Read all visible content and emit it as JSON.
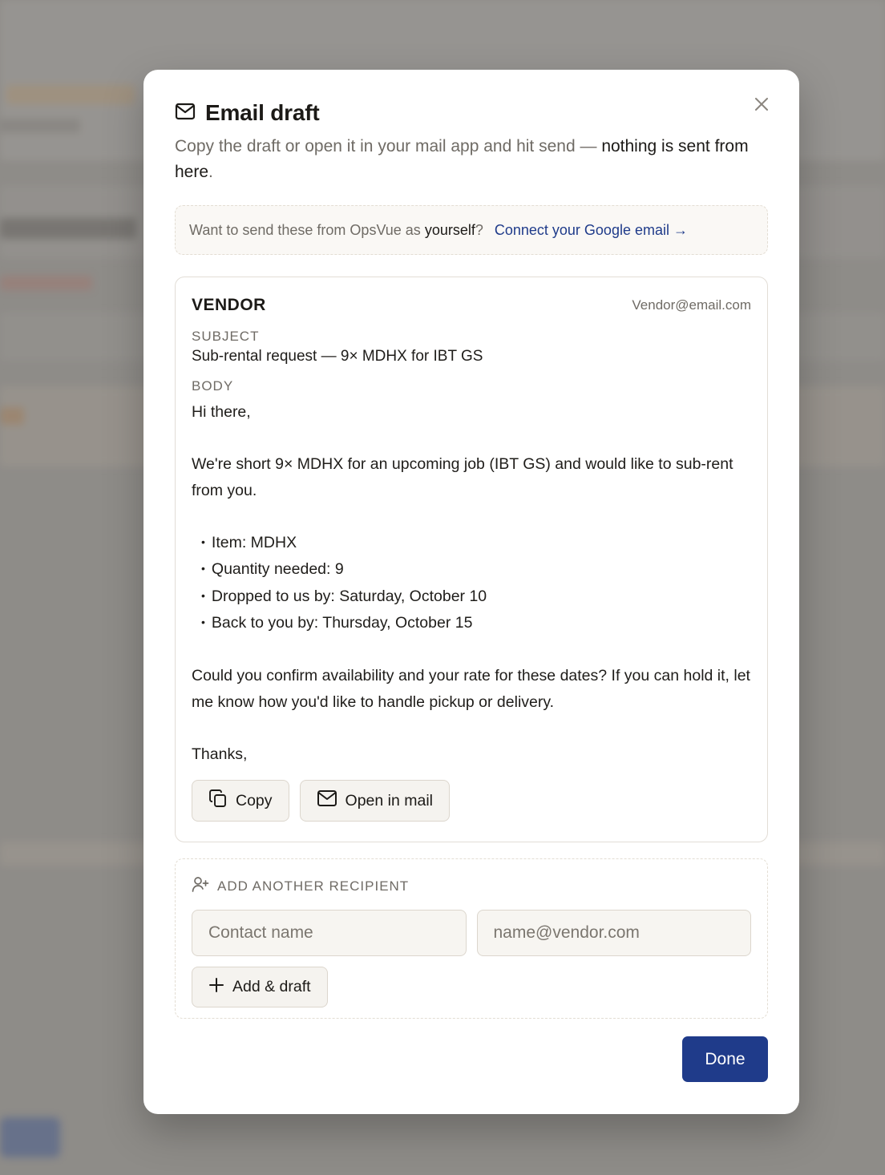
{
  "modal": {
    "title": "Email draft",
    "subtitle_prefix": "Copy the draft or open it in your mail app and hit send — ",
    "subtitle_strong": "nothing is sent from here",
    "subtitle_suffix": ".",
    "close_icon": "close-icon"
  },
  "connect": {
    "prefix": "Want to send these from OpsVue as ",
    "strong": "yourself",
    "suffix": "?",
    "link": "Connect your Google email →"
  },
  "draft": {
    "vendor_label": "VENDOR",
    "vendor_email": "Vendor@email.com",
    "subject_label": "SUBJECT",
    "subject": "Sub-rental request — 9× MDHX for IBT GS",
    "body_label": "BODY",
    "greeting": "Hi there,",
    "intro": "We're short 9× MDHX for an upcoming job (IBT GS) and would like to sub-rent from you.",
    "items": [
      "Item: MDHX",
      "Quantity needed: 9",
      "Dropped to us by: Saturday, October 10",
      "Back to you by: Thursday, October 15"
    ],
    "closing_question": "Could you confirm availability and your rate for these dates? If you can hold it, let me know how you'd like to handle pickup or delivery.",
    "signoff": "Thanks,",
    "copy_label": "Copy",
    "open_mail_label": "Open in mail"
  },
  "add_recipient": {
    "heading": "ADD ANOTHER RECIPIENT",
    "name_placeholder": "Contact name",
    "email_placeholder": "name@vendor.com",
    "add_label": "Add & draft"
  },
  "footer": {
    "done_label": "Done"
  },
  "colors": {
    "accent": "#1f3b8a",
    "muted_text": "#6f6b65"
  }
}
